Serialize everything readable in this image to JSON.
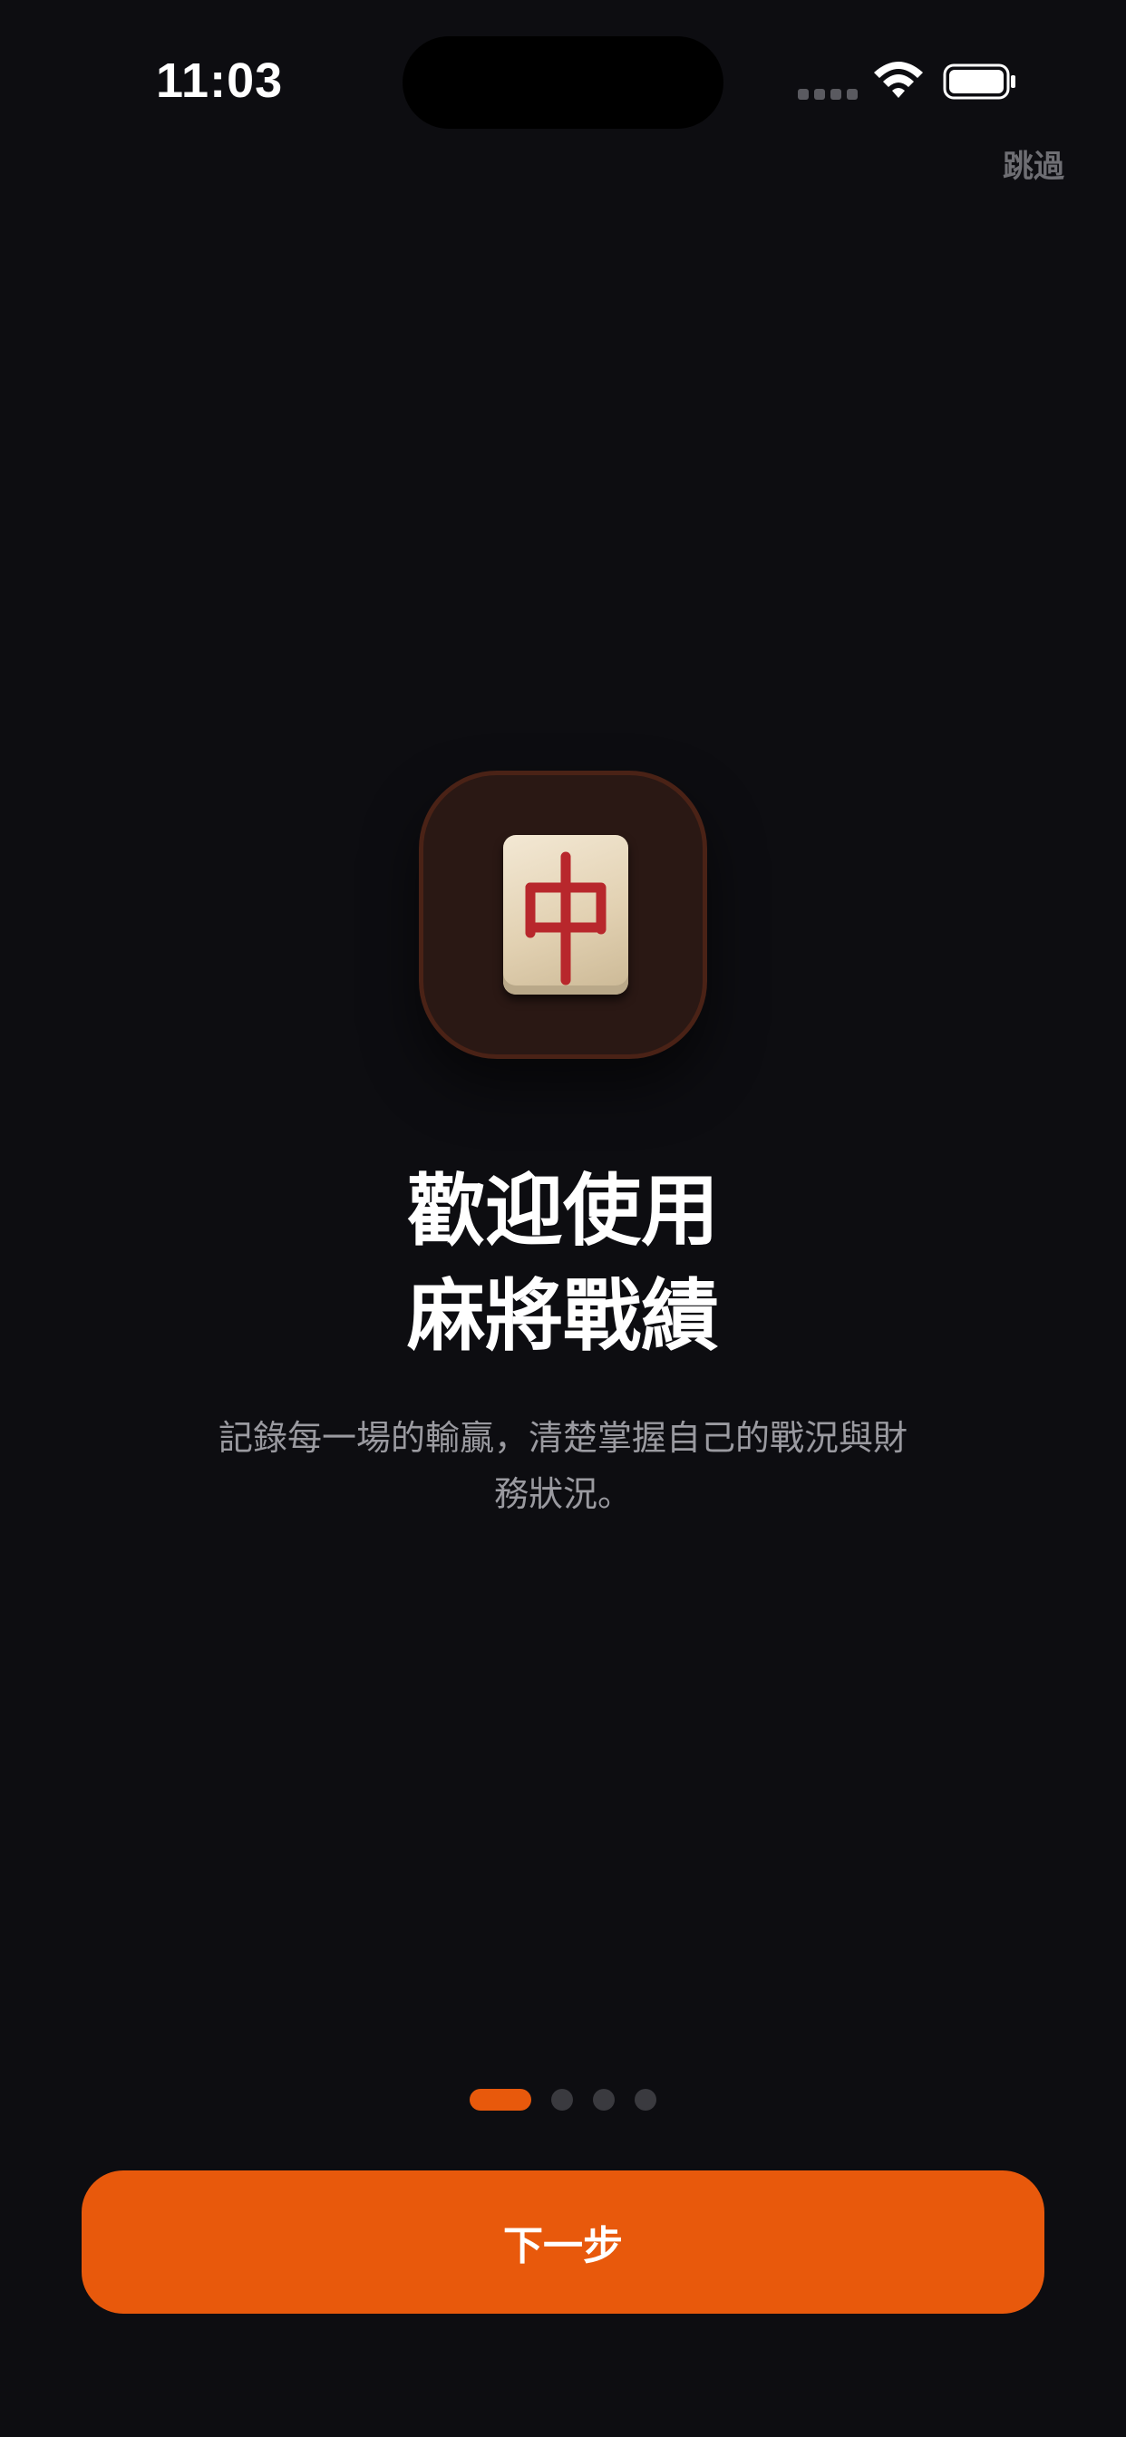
{
  "status_bar": {
    "time": "11:03"
  },
  "header": {
    "skip_label": "跳過"
  },
  "hero": {
    "icon": "mahjong-red-dragon-tile-icon",
    "tile_glyph": "中",
    "title_line1": "歡迎使用",
    "title_line2": "麻將戰績",
    "subtitle_line1": "記錄每一場的輸贏，清楚掌握自己的戰況與財",
    "subtitle_line2": "務狀況。"
  },
  "pager": {
    "current_page": 1,
    "total_pages": 4
  },
  "footer": {
    "next_label": "下一步"
  },
  "colors": {
    "background": "#0d0d11",
    "accent": "#e8590c",
    "tile_red": "#b8272c",
    "muted_text": "#9a9aa0"
  }
}
